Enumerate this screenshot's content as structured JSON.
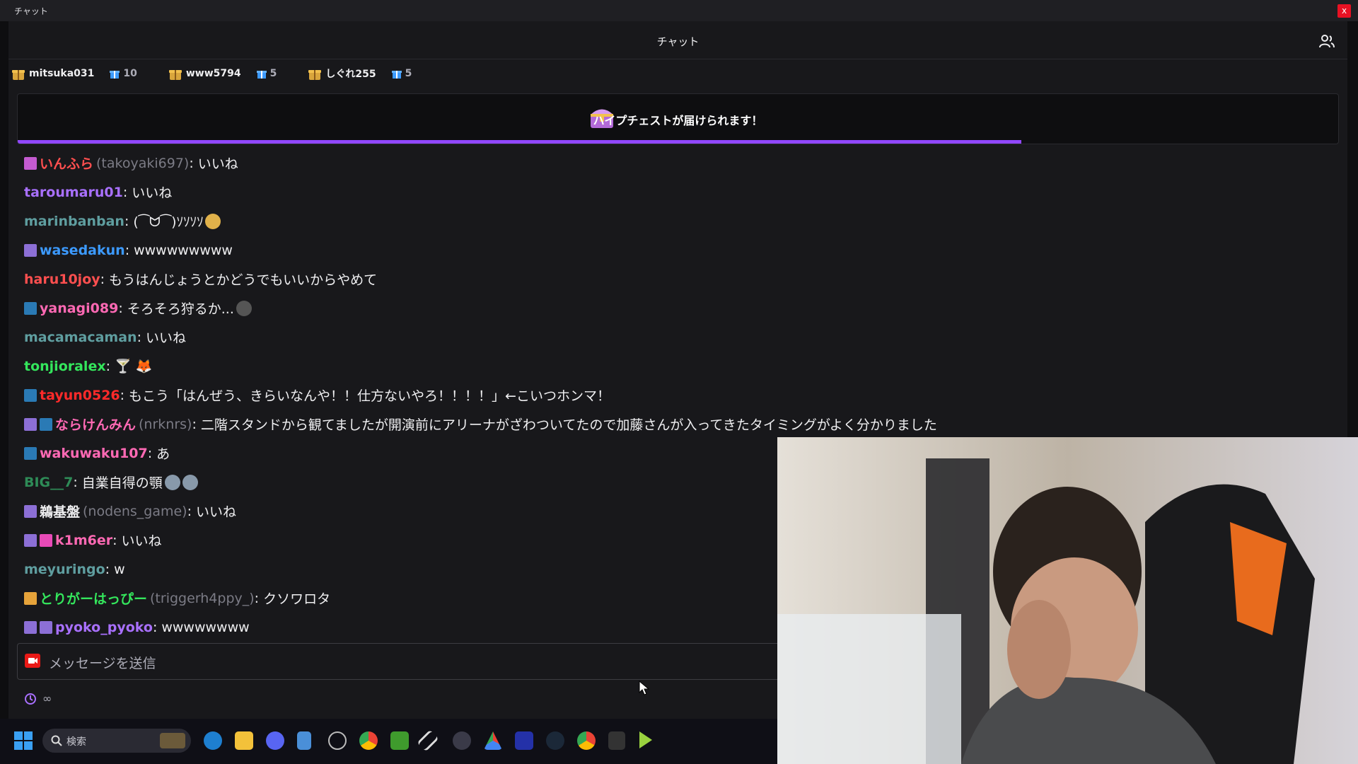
{
  "window": {
    "title": "チャット",
    "close_label": "x"
  },
  "chat": {
    "header_title": "チャット",
    "gifters": [
      {
        "name": "mitsuka031",
        "count": "10"
      },
      {
        "name": "www5794",
        "count": "5"
      },
      {
        "name": "しぐれ255",
        "count": "5"
      }
    ],
    "hype_banner": {
      "text": "ハイプチェストが届けられます！",
      "progress": 0.76
    },
    "messages": [
      {
        "user": "いんふら",
        "login": "(takoyaki697)",
        "text": "いいね",
        "color": "#ff4f4f",
        "badges": [
          "#c45bd1"
        ]
      },
      {
        "user": "taroumaru01",
        "login": "",
        "text": "いいね",
        "color": "#a970ff",
        "badges": []
      },
      {
        "user": "marinbanban",
        "login": "",
        "text": "(⁀ᗢ⁀)ｿｿｿｿ",
        "color": "#5f9ea0",
        "badges": [],
        "emote": "#e0b14a"
      },
      {
        "user": "wasedakun",
        "login": "",
        "text": "wwwwwwwww",
        "color": "#3c9aff",
        "badges": [
          "#8c6fd6"
        ]
      },
      {
        "user": "haru10joy",
        "login": "",
        "text": "もうはんじょうとかどうでもいいからやめて",
        "color": "#ff4f4f",
        "badges": []
      },
      {
        "user": "yanagi089",
        "login": "",
        "text": "そろそろ狩るか...",
        "color": "#ff69b4",
        "badges": [
          "#2a7ab5"
        ],
        "emote": "#555"
      },
      {
        "user": "macamacaman",
        "login": "",
        "text": "いいね",
        "color": "#5f9ea0",
        "badges": []
      },
      {
        "user": "tonjioralex",
        "login": "",
        "text": "🍸 🦊",
        "color": "#34e65c",
        "badges": []
      },
      {
        "user": "tayun0526",
        "login": "",
        "text": "もこう「はんぜう、きらいなんや！！仕方ないやろ！！！！」←こいつホンマ！",
        "color": "#ff2a2a",
        "badges": [
          "#2a7ab5"
        ]
      },
      {
        "user": "ならけんみん",
        "login": "(nrknrs)",
        "text": "二階スタンドから観てましたが開演前にアリーナがざわついてたので加藤さんが入ってきたタイミングがよく分かりました",
        "color": "#ff69b4",
        "badges": [
          "#8c6fd6",
          "#2a7ab5"
        ]
      },
      {
        "user": "wakuwaku107",
        "login": "",
        "text": "あ",
        "color": "#ff69b4",
        "badges": [
          "#2a7ab5"
        ]
      },
      {
        "user": "BIG__7",
        "login": "",
        "text": "自業自得の顎",
        "color": "#2e8b57",
        "badges": [],
        "emote": "#8899aa",
        "emote2": "#8899aa"
      },
      {
        "user": "鵜基盤",
        "login": "(nodens_game)",
        "text": "いいね",
        "color": "#efeff1",
        "badges": [
          "#8c6fd6"
        ]
      },
      {
        "user": "k1m6er",
        "login": "",
        "text": "いいね",
        "color": "#ff69b4",
        "badges": [
          "#8c6fd6",
          "#e94ab8"
        ]
      },
      {
        "user": "meyuringo",
        "login": "",
        "text": "w",
        "color": "#5f9ea0",
        "badges": []
      },
      {
        "user": "とりがーはっぴー",
        "login": "(triggerh4ppy_)",
        "text": "クソワロタ",
        "color": "#34e65c",
        "badges": [
          "#e6a33a"
        ]
      },
      {
        "user": "pyoko_pyoko",
        "login": "",
        "text": "wwwwwwww",
        "color": "#a970ff",
        "badges": [
          "#8c6fd6",
          "#8c6fd6"
        ]
      }
    ],
    "input_placeholder": "メッセージを送信",
    "points": "∞"
  },
  "taskbar": {
    "search_label": "検索"
  },
  "colors": {
    "accent": "#9147ff",
    "background": "#18181b"
  },
  "icons": [
    "users-icon",
    "gift-icon",
    "treasure-chest-icon",
    "camera-icon",
    "timer-icon",
    "windows-start-icon",
    "search-icon",
    "edge-icon",
    "file-explorer-icon",
    "discord-icon",
    "chrome-icon",
    "steam-icon",
    "cursor-icon"
  ]
}
